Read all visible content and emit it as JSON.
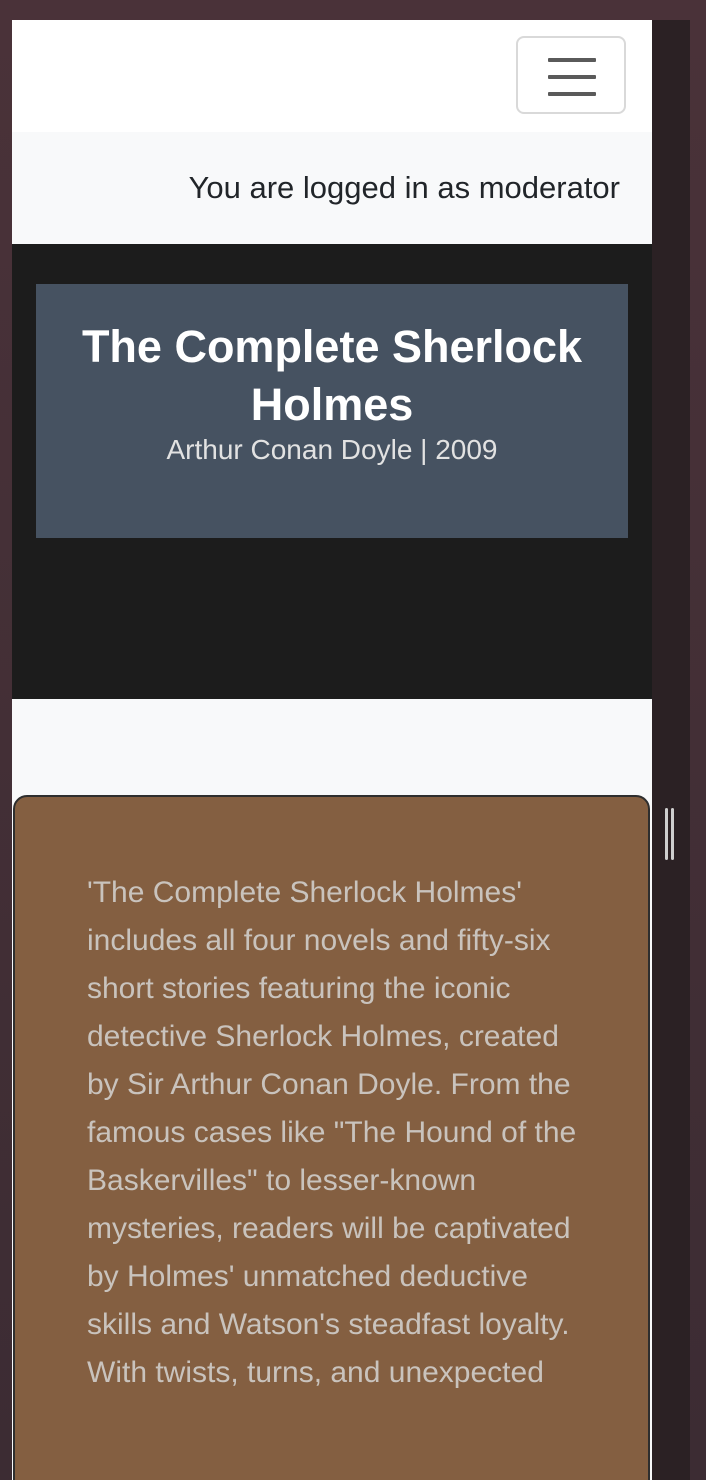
{
  "navbar": {
    "toggler_icon": "hamburger-menu-icon"
  },
  "session": {
    "login_status": "You are logged in as moderator"
  },
  "book": {
    "title": "The Complete Sherlock Holmes",
    "meta": "Arthur Conan Doyle | 2009",
    "description": "'The Complete Sherlock Holmes' includes all four novels and fifty-six short stories featuring the iconic detective Sherlock Holmes, created by Sir Arthur Conan Doyle. From the famous cases like \"The Hound of the Baskervilles\" to lesser-known mysteries, readers will be captivated by Holmes' unmatched deductive skills and Watson's steadfast loyalty. With twists, turns, and unexpected"
  },
  "colors": {
    "hero_background": "#1c1c1c",
    "title_card": "#465261",
    "description_card": "#845f41",
    "page_background": "#f8f9fa"
  }
}
